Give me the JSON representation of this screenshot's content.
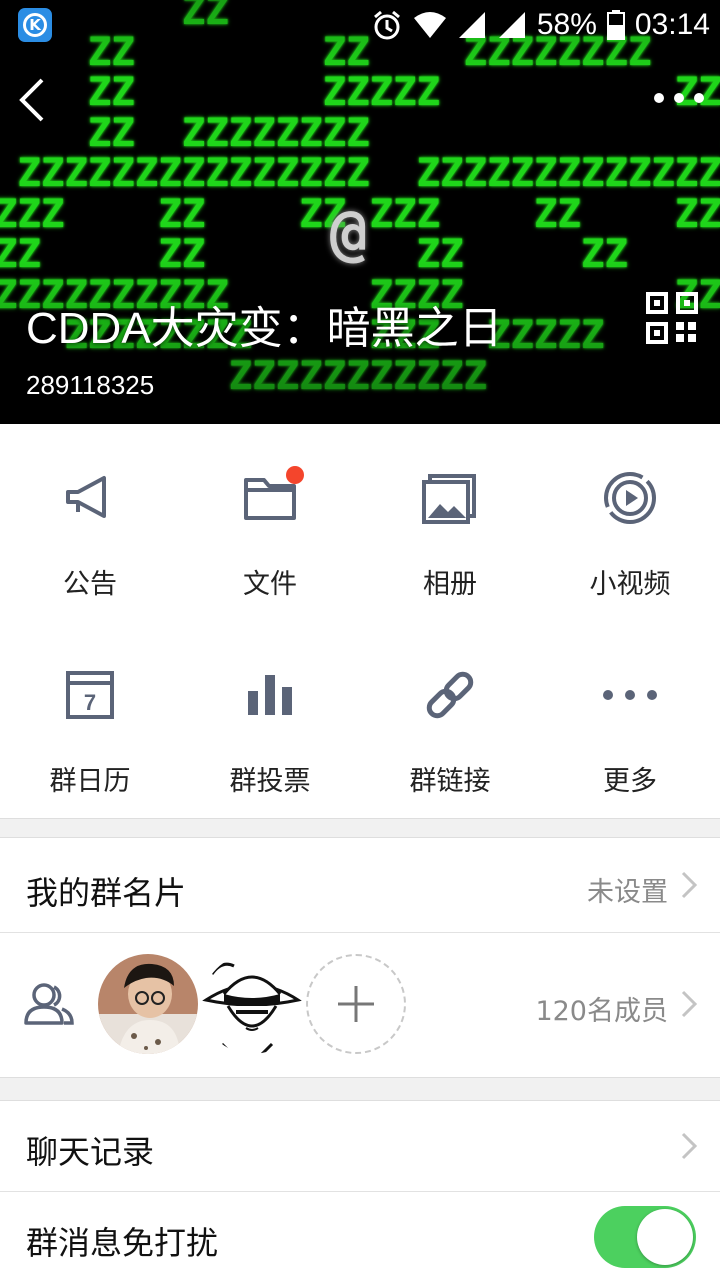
{
  "status_bar": {
    "battery": "58%",
    "time": "03:14"
  },
  "header": {
    "title": "CDDA大灾变：暗黑之日",
    "group_id": "289118325",
    "art_symbol": "@"
  },
  "features": [
    {
      "label": "公告",
      "icon": "megaphone-icon"
    },
    {
      "label": "文件",
      "icon": "folder-icon",
      "badge": true
    },
    {
      "label": "相册",
      "icon": "album-icon"
    },
    {
      "label": "小视频",
      "icon": "video-icon"
    },
    {
      "label": "群日历",
      "icon": "calendar-icon",
      "calendar_day": "7"
    },
    {
      "label": "群投票",
      "icon": "poll-icon"
    },
    {
      "label": "群链接",
      "icon": "link-icon"
    },
    {
      "label": "更多",
      "icon": "more-icon"
    }
  ],
  "my_card": {
    "label": "我的群名片",
    "value": "未设置"
  },
  "members": {
    "count_label": "120名成员"
  },
  "chat_history": {
    "label": "聊天记录"
  },
  "do_not_disturb": {
    "label": "群消息免打扰",
    "enabled": true
  },
  "colors": {
    "accent_green": "#4cd05f",
    "badge_red": "#f4452c",
    "icon_gray": "#5b6478",
    "matrix_green": "#1fd61a"
  }
}
